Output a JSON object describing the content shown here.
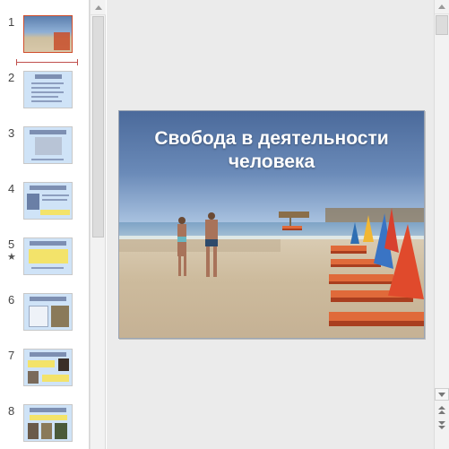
{
  "thumbnails": {
    "items": [
      {
        "number": "1",
        "label": "Свобода в деятельности человека"
      },
      {
        "number": "2"
      },
      {
        "number": "3"
      },
      {
        "number": "4"
      },
      {
        "number": "5",
        "has_animation": true
      },
      {
        "number": "6"
      },
      {
        "number": "7"
      },
      {
        "number": "8"
      }
    ],
    "selected_index": 0,
    "accent_color": "#d04d2b"
  },
  "slide": {
    "title": "Свобода в деятельности человека"
  },
  "icons": {
    "animation": "star-icon",
    "scroll_up": "chevron-up-icon",
    "scroll_down": "chevron-down-icon",
    "previous_slide": "double-chevron-up-icon",
    "next_slide": "double-chevron-down-icon"
  }
}
